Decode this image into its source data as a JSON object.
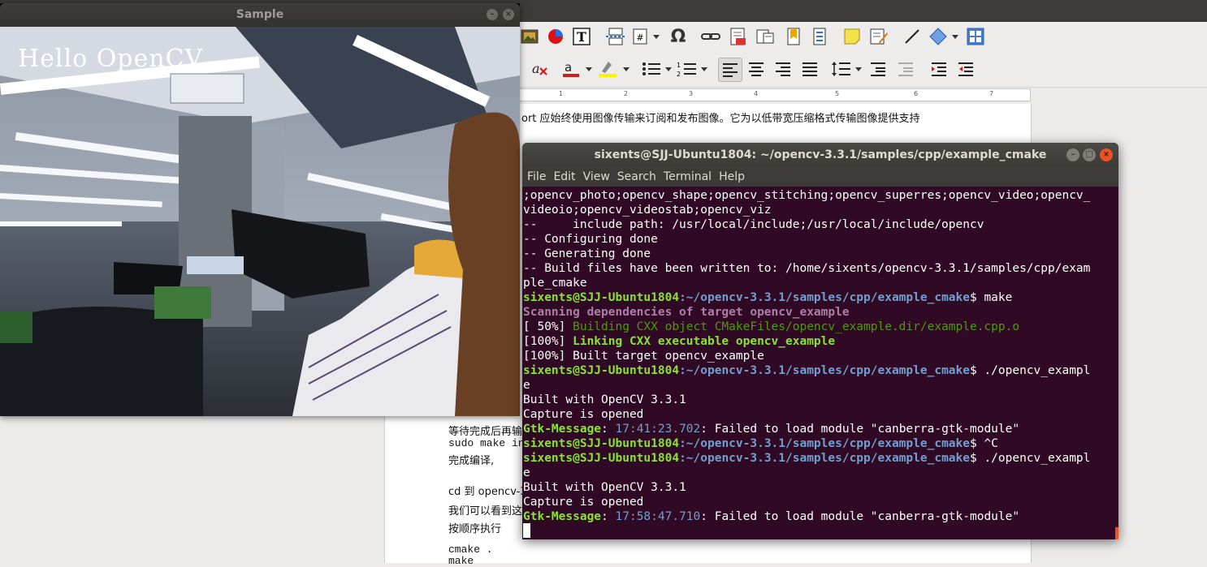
{
  "writer": {
    "doc_lines": [
      {
        "text": "ort 应始终使用图像传输来订阅和发布图像。它为以低带宽压缩格式传输图像提供支持"
      },
      {
        "text": "等待完成后再输"
      },
      {
        "text": "sudo make in"
      },
      {
        "text": "完成编译,"
      },
      {
        "text": "cd 到 opencv-3"
      },
      {
        "text": "我们可以看到这"
      },
      {
        "text": "按顺序执行"
      },
      {
        "text": "cmake ."
      },
      {
        "text": "make"
      }
    ],
    "ruler_marks": [
      "1",
      "2",
      "3",
      "4",
      "5",
      "6",
      "7"
    ],
    "accent_colors": {
      "toolbar_bg": "#edeceb",
      "page": "#ffffff"
    }
  },
  "sample_window": {
    "title": "Sample",
    "overlay_text": "Hello OpenCV"
  },
  "terminal": {
    "title": "sixents@SJJ-Ubuntu1804: ~/opencv-3.3.1/samples/cpp/example_cmake",
    "menu": [
      "File",
      "Edit",
      "View",
      "Search",
      "Terminal",
      "Help"
    ],
    "colors": {
      "bg": "#300a24",
      "prompt_user": "#8ae234",
      "prompt_path": "#729fcf"
    },
    "lines": {
      "l0": ";opencv_photo;opencv_shape;opencv_stitching;opencv_superres;opencv_video;opencv_",
      "l1": "videoio;opencv_videostab;opencv_viz",
      "l2": "--     include path: /usr/local/include;/usr/local/include/opencv",
      "l3": "-- Configuring done",
      "l4": "-- Generating done",
      "l5": "-- Build files have been written to: /home/sixents/opencv-3.3.1/samples/cpp/exam",
      "l6": "ple_cmake",
      "p7_user": "sixents@SJJ-Ubuntu1804",
      "p7_path": ":~/opencv-3.3.1/samples/cpp/example_cmake",
      "p7_cmd": "$ make",
      "l8": "Scanning dependencies of target opencv_example",
      "l9a": "[ 50%] ",
      "l9b": "Building CXX object CMakeFiles/opencv_example.dir/example.cpp.o",
      "l10a": "[100%] ",
      "l10b": "Linking CXX executable opencv_example",
      "l11": "[100%] Built target opencv_example",
      "p12_user": "sixents@SJJ-Ubuntu1804",
      "p12_path": ":~/opencv-3.3.1/samples/cpp/example_cmake",
      "p12_cmd": "$ ./opencv_exampl",
      "l13": "e",
      "l14": "Built with OpenCV 3.3.1",
      "l15": "Capture is opened",
      "l16a": "Gtk-Message",
      "l16b": ": ",
      "l16c": "17:41:23.702",
      "l16d": ": Failed to load module \"canberra-gtk-module\"",
      "p17_user": "sixents@SJJ-Ubuntu1804",
      "p17_path": ":~/opencv-3.3.1/samples/cpp/example_cmake",
      "p17_cmd": "$ ^C",
      "p18_user": "sixents@SJJ-Ubuntu1804",
      "p18_path": ":~/opencv-3.3.1/samples/cpp/example_cmake",
      "p18_cmd": "$ ./opencv_exampl",
      "l19": "e",
      "l20": "Built with OpenCV 3.3.1",
      "l21": "Capture is opened",
      "l22a": "Gtk-Message",
      "l22b": ": ",
      "l22c": "17:58:47.710",
      "l22d": ": Failed to load module \"canberra-gtk-module\""
    }
  }
}
